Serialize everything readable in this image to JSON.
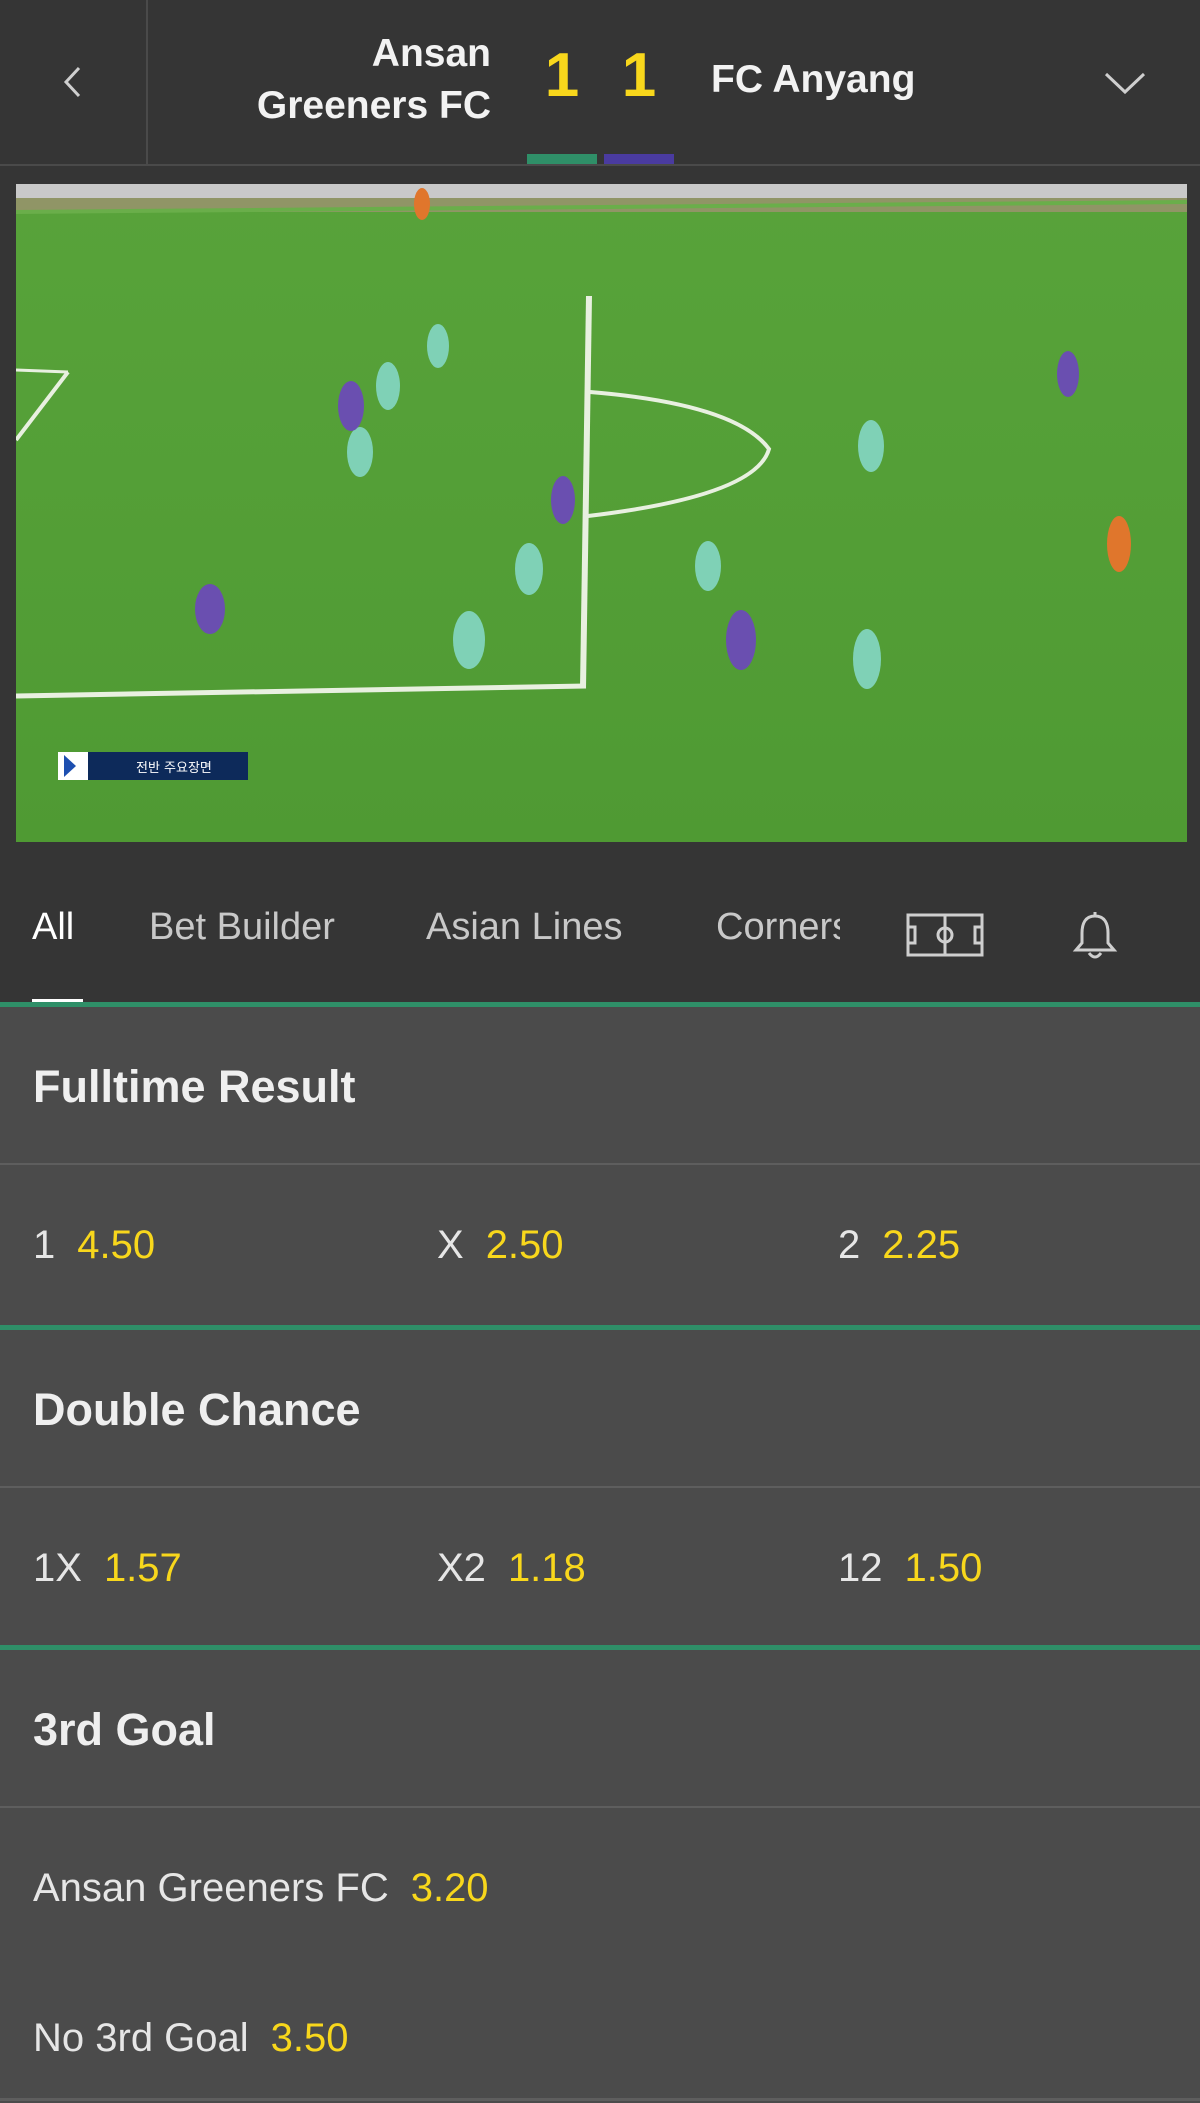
{
  "header": {
    "home_team": "Ansan Greeners FC",
    "away_team": "FC Anyang",
    "home_score": "1",
    "away_score": "1",
    "colors": {
      "home": "#2f8f68",
      "away": "#4a3ba0",
      "score": "#f8d71c"
    }
  },
  "video": {
    "broadcast_caption": "전반 주요장면"
  },
  "tabs": [
    {
      "label": "All",
      "active": true
    },
    {
      "label": "Bet Builder",
      "active": false
    },
    {
      "label": "Asian Lines",
      "active": false
    },
    {
      "label": "Corners",
      "active": false
    }
  ],
  "tab_icons": [
    "pitch-icon",
    "bell-icon"
  ],
  "markets": [
    {
      "title": "Fulltime Result",
      "odds": [
        {
          "label": "1",
          "value": "4.50"
        },
        {
          "label": "X",
          "value": "2.50"
        },
        {
          "label": "2",
          "value": "2.25"
        }
      ]
    },
    {
      "title": "Double Chance",
      "odds": [
        {
          "label": "1X",
          "value": "1.57"
        },
        {
          "label": "X2",
          "value": "1.18"
        },
        {
          "label": "12",
          "value": "1.50"
        }
      ]
    },
    {
      "title": "3rd Goal",
      "odds": [
        {
          "label": "Ansan Greeners FC",
          "value": "3.20"
        },
        {
          "label": "No 3rd Goal",
          "value": "3.50"
        }
      ]
    }
  ]
}
